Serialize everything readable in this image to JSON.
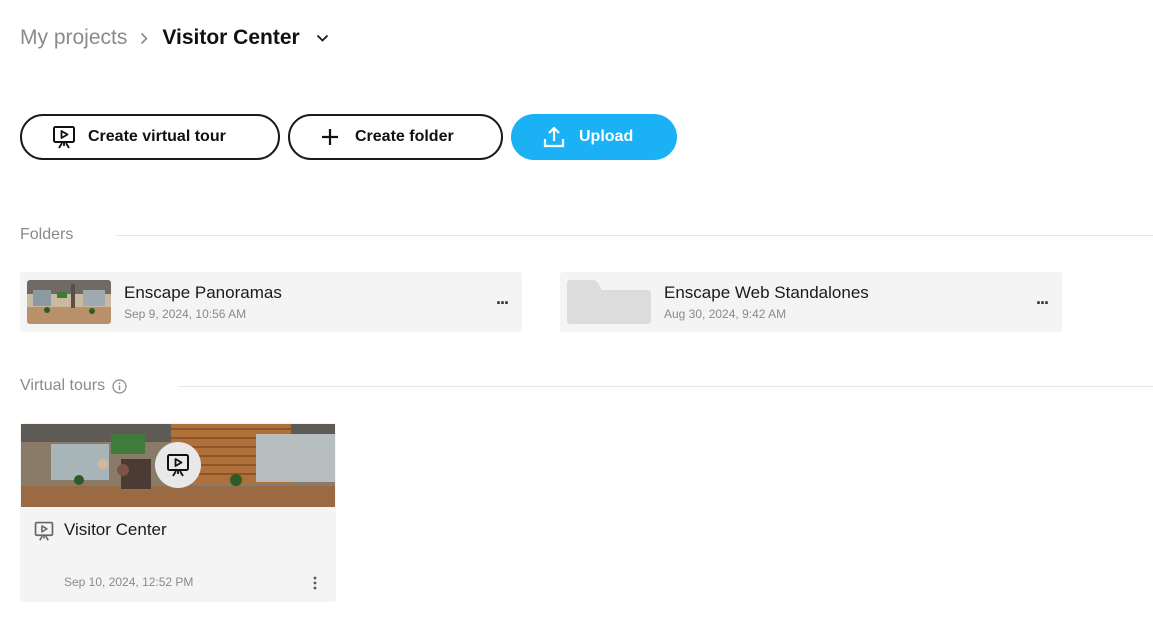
{
  "breadcrumb": {
    "root": "My projects",
    "current": "Visitor Center"
  },
  "toolbar": {
    "create_tour_label": "Create virtual tour",
    "create_folder_label": "Create folder",
    "upload_label": "Upload"
  },
  "sections": {
    "folders_title": "Folders",
    "tours_title": "Virtual tours"
  },
  "folders": [
    {
      "name": "Enscape Panoramas",
      "date": "Sep 9, 2024, 10:56 AM",
      "menu": "..."
    },
    {
      "name": "Enscape Web Standalones",
      "date": "Aug 30, 2024, 9:42 AM",
      "menu": "..."
    }
  ],
  "tours": [
    {
      "name": "Visitor Center",
      "date": "Sep 10, 2024, 12:52 PM"
    }
  ],
  "colors": {
    "accent": "#1ab2f5",
    "card_bg": "#f4f4f4",
    "muted_text": "#8a8a8a"
  },
  "icons": {
    "tour": "presentation-play-icon",
    "folder": "plus-icon",
    "upload": "upload-icon",
    "info": "info-icon"
  }
}
